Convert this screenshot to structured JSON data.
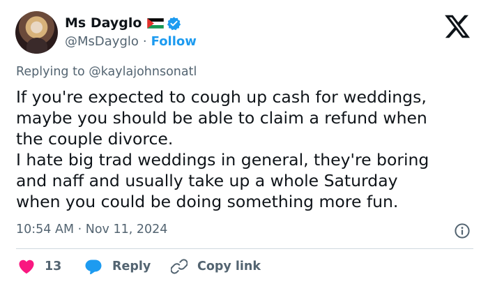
{
  "author": {
    "name": "Ms Dayglo",
    "handle": "@MsDayglo",
    "separator": "·",
    "follow_label": "Follow",
    "flag_icon": "palestine-flag-icon",
    "verified_icon": "verified-badge-icon"
  },
  "tweet": {
    "replying_to": "Replying to @kaylajohnsonatl",
    "lines": [
      "If you're expected to cough up cash for weddings,",
      "maybe you should be able to claim a refund when",
      "the couple divorce.",
      "I hate big trad weddings in general, they're boring",
      "and naff and usually take up a whole Saturday",
      "when you could be doing something more fun."
    ],
    "timestamp": "10:54 AM · Nov 11, 2024"
  },
  "actions": {
    "like_count": "13",
    "reply_label": "Reply",
    "copy_link_label": "Copy link"
  },
  "colors": {
    "like": "#f91880",
    "reply": "#1d9bf0",
    "follow": "#1d9bf0",
    "muted": "#536471",
    "verified": "#1d9bf0"
  }
}
